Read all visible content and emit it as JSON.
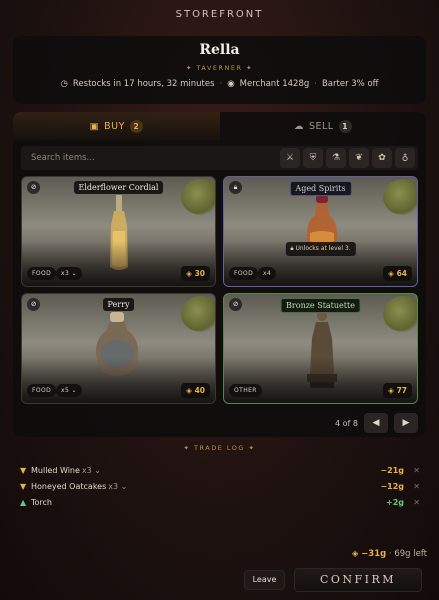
{
  "topbar": {
    "title": "STOREFRONT"
  },
  "merchant": {
    "name": "Rella",
    "role": "TAVERNER",
    "restock_text": "Restocks in 17 hours, 32 minutes",
    "merchant_gold": "Merchant 1428g",
    "barter": "Barter 3% off"
  },
  "tabs": {
    "buy": {
      "label": "BUY",
      "count": "2"
    },
    "sell": {
      "label": "SELL",
      "count": "1"
    }
  },
  "search": {
    "placeholder": "Search items..."
  },
  "filters": [
    {
      "icon": "weapon-icon"
    },
    {
      "icon": "armor-icon"
    },
    {
      "icon": "potion-icon"
    },
    {
      "icon": "food-icon"
    },
    {
      "icon": "misc-icon"
    },
    {
      "icon": "bag-icon"
    }
  ],
  "items": [
    {
      "name": "Elderflower Cordial",
      "category": "FOOD",
      "qty": "x3",
      "price": "30",
      "state": "normal"
    },
    {
      "name": "Aged Spirits",
      "category": "FOOD",
      "qty": "x4",
      "price": "64",
      "state": "locked",
      "lock_note": "Unlocks at level 3."
    },
    {
      "name": "Perry",
      "category": "FOOD",
      "qty": "x5",
      "price": "40",
      "state": "normal"
    },
    {
      "name": "Bronze Statuette",
      "category": "OTHER",
      "qty": "",
      "price": "77",
      "state": "special"
    }
  ],
  "pager": {
    "text": "4 of 8"
  },
  "trade_log": {
    "heading": "TRADE LOG",
    "rows": [
      {
        "name": "Mulled Wine",
        "qty": "x3",
        "amount": "−21g",
        "dir": "in"
      },
      {
        "name": "Honeyed Oatcakes",
        "qty": "x3",
        "amount": "−12g",
        "dir": "in"
      },
      {
        "name": "Torch",
        "qty": "",
        "amount": "+2g",
        "dir": "out"
      }
    ]
  },
  "summary": {
    "total": "−31g",
    "left": "69g left"
  },
  "actions": {
    "leave": "Leave",
    "confirm": "CONFIRM"
  }
}
